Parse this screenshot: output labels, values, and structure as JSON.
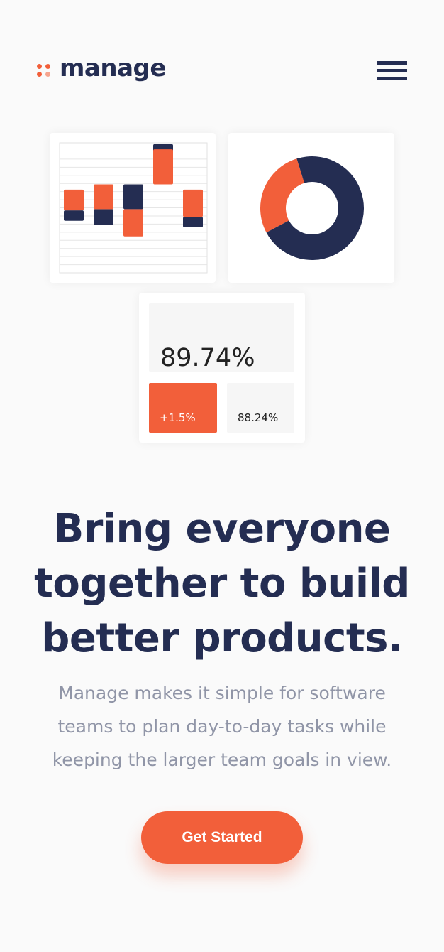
{
  "header": {
    "logo_text": "manage",
    "menu_icon": "hamburger-menu-icon"
  },
  "illustration": {
    "bar_chart": {
      "type": "floating-bar",
      "bars": [
        {
          "orange": [
            0.48,
            0.64
          ],
          "navy": [
            0.4,
            0.48
          ]
        },
        {
          "orange": [
            0.49,
            0.68
          ],
          "navy": [
            0.37,
            0.49
          ]
        },
        {
          "orange": [
            0.28,
            0.49
          ],
          "navy": [
            0.49,
            0.68
          ]
        },
        {
          "orange": [
            0.68,
            0.95
          ],
          "navy": [
            0.91,
            0.99
          ]
        },
        {
          "orange": [
            0.43,
            0.64
          ],
          "navy": [
            0.35,
            0.43
          ]
        }
      ]
    },
    "donut_chart": {
      "type": "donut",
      "segments": [
        {
          "label": "orange",
          "percent": 28,
          "color": "#f25f3a"
        },
        {
          "label": "navy",
          "percent": 72,
          "color": "#242d52"
        }
      ]
    },
    "stats": {
      "main_value": "89.74%",
      "change_value": "+1.5%",
      "previous_value": "88.24%"
    }
  },
  "hero": {
    "headline_lines": [
      "Bring everyone",
      "together to build",
      "better products."
    ],
    "subtext_lines": [
      "Manage makes it simple for software",
      "teams to plan day-to-day tasks while",
      "keeping the larger team goals in view."
    ],
    "cta_label": "Get Started"
  },
  "colors": {
    "accent": "#f25f3a",
    "accent_light": "#f6a58f",
    "navy": "#242d52",
    "muted_text": "#9095a7",
    "background": "#fafafa"
  }
}
